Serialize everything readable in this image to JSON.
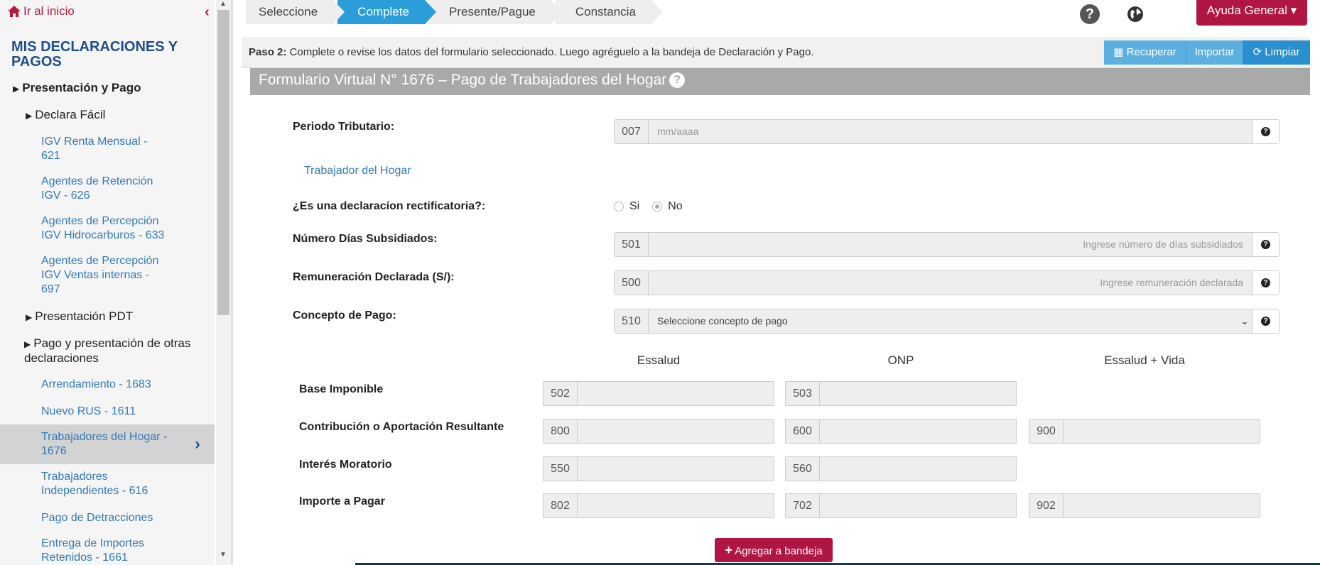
{
  "sidebar": {
    "home_label": "Ir al inicio",
    "title": "MIS DECLARACIONES Y PAGOS",
    "sections": {
      "presentacion_pago": "Presentación y Pago",
      "declara_facil": "Declara Fácil",
      "presentacion_pdt": "Presentación PDT",
      "otras": "Pago y presentación de otras declaraciones"
    },
    "declara_items": [
      {
        "line1": "IGV Renta Mensual -",
        "line2": "621"
      },
      {
        "line1": "Agentes de Retención",
        "line2": "IGV - 626"
      },
      {
        "line1": "Agentes de Percepción",
        "line2": "IGV Hidrocarburos - 633"
      },
      {
        "line1": "Agentes de Percepción",
        "line2": "IGV Ventas internas -",
        "line3": "697"
      }
    ],
    "otras_items": [
      {
        "line1": "Arrendamiento - 1683"
      },
      {
        "line1": "Nuevo RUS - 1611"
      },
      {
        "line1": "Trabajadores del Hogar -",
        "line2": "1676"
      },
      {
        "line1": "Trabajadores",
        "line2": "Independientes - 616"
      },
      {
        "line1": "Pago de Detracciones"
      },
      {
        "line1": "Entrega de Importes",
        "line2": "Retenidos - 1661"
      }
    ]
  },
  "steps": [
    "Seleccione",
    "Complete",
    "Presente/Pague",
    "Constancia"
  ],
  "header": {
    "help_label": "Ayuda General",
    "caret": "▾"
  },
  "paso": {
    "bold": "Paso 2:",
    "text": "Complete o revise los datos del formulario seleccionado. Luego agréguelo a la bandeja de Declaración y Pago."
  },
  "toolbar": {
    "recuperar": "Recuperar",
    "importar": "Importar",
    "limpiar": "Limpiar"
  },
  "form": {
    "title": "Formulario Virtual N° 1676 – Pago de Trabajadores del Hogar",
    "periodo_label": "Periodo Tributario:",
    "periodo_code": "007",
    "periodo_placeholder": "mm/aaaa",
    "trabajador_link": "Trabajador del Hogar",
    "rectificatoria_label": "¿Es una declaracíon rectificatoria?:",
    "rect_si": "Si",
    "rect_no": "No",
    "dias_label": "Número Días Subsidiados:",
    "dias_code": "501",
    "dias_placeholder": "Ingrese número de días subsidiados",
    "rem_label": "Remuneración Declarada (S/):",
    "rem_code": "500",
    "rem_placeholder": "Ingrese remuneración declarada",
    "concepto_label": "Concepto de Pago:",
    "concepto_code": "510",
    "concepto_value": "Seleccione concepto de pago"
  },
  "grid": {
    "columns": [
      "Essalud",
      "ONP",
      "Essalud + Vida"
    ],
    "rows": [
      {
        "label": "Base Imponible",
        "codes": [
          "502",
          "503",
          ""
        ]
      },
      {
        "label": "Contribución o Aportación Resultante",
        "codes": [
          "800",
          "600",
          "900"
        ]
      },
      {
        "label": "Interés Moratorio",
        "codes": [
          "550",
          "560",
          ""
        ]
      },
      {
        "label": "Importe a Pagar",
        "codes": [
          "802",
          "702",
          "902"
        ]
      }
    ]
  },
  "actions": {
    "add_label": "Agregar a bandeja"
  }
}
